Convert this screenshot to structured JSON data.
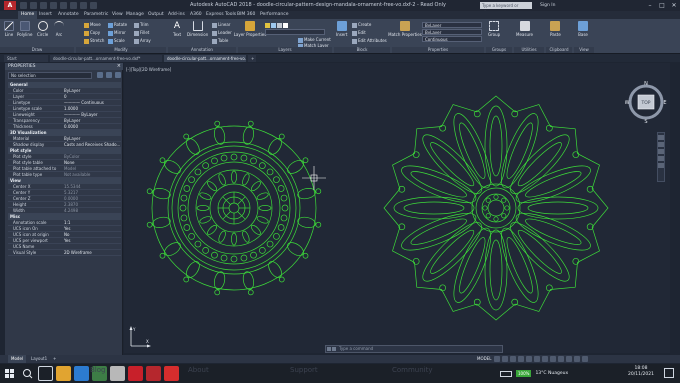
{
  "window": {
    "app_icon": "A",
    "title": "Autodesk AutoCAD 2018 - doodle-circular-pattern-design-mandala-ornament-free-vo.dxf-2 - Read Only",
    "search_placeholder": "Type a keyword or phrase",
    "signin": "Sign In"
  },
  "menu": [
    "Home",
    "Insert",
    "Annotate",
    "Parametric",
    "View",
    "Manage",
    "Output",
    "Add-ins",
    "A360",
    "Express Tools",
    "BIM 360",
    "Performance"
  ],
  "ribbon": {
    "draw": {
      "line": "Line",
      "polyline": "Polyline",
      "circle": "Circle",
      "arc": "Arc",
      "panel": "Draw"
    },
    "modify": {
      "move": "Move",
      "rotate": "Rotate",
      "trim": "Trim",
      "copy": "Copy",
      "mirror": "Mirror",
      "fillet": "Fillet",
      "stretch": "Stretch",
      "scale": "Scale",
      "array": "Array",
      "panel": "Modify"
    },
    "annotation": {
      "text": "Text",
      "dimension": "Dimension",
      "linear": "Linear",
      "leader": "Leader",
      "table": "Table",
      "panel": "Annotation"
    },
    "layers": {
      "layer_properties": "Layer Properties",
      "make_current": "Make Current",
      "match_layer": "Match Layer",
      "panel": "Layers"
    },
    "block": {
      "insert": "Insert",
      "create": "Create",
      "edit": "Edit",
      "edit_attributes": "Edit Attributes",
      "panel": "Block"
    },
    "properties": {
      "match_properties": "Match Properties",
      "bylayer1": "ByLayer",
      "bylayer2": "ByLayer",
      "continuous": "Continuous",
      "panel": "Properties"
    },
    "groups": {
      "group": "Group",
      "panel": "Groups"
    },
    "utilities": {
      "measure": "Measure",
      "panel": "Utilities"
    },
    "clipboard": {
      "paste": "Paste",
      "panel": "Clipboard"
    },
    "view": {
      "base": "Base",
      "panel": "View"
    }
  },
  "doc_tabs": [
    "Start",
    "doodle-circular-patt...ornament-free-vo.dxf*",
    "doodle-circular-patt...ornament-free-vo.dxf-2*"
  ],
  "properties_panel": {
    "title": "PROPERTIES",
    "selection": "No selection",
    "sections": [
      {
        "name": "General",
        "rows": [
          {
            "k": "Color",
            "v": "ByLayer"
          },
          {
            "k": "Layer",
            "v": "0"
          },
          {
            "k": "Linetype",
            "v": "———— Continuous"
          },
          {
            "k": "Linetype scale",
            "v": "1.0000"
          },
          {
            "k": "Lineweight",
            "v": "———— ByLayer"
          },
          {
            "k": "Transparency",
            "v": "ByLayer"
          },
          {
            "k": "Thickness",
            "v": "0.0000"
          }
        ]
      },
      {
        "name": "3D Visualization",
        "rows": [
          {
            "k": "Material",
            "v": "ByLayer"
          },
          {
            "k": "Shadow display",
            "v": "Casts and Receives Shado..."
          }
        ]
      },
      {
        "name": "Plot style",
        "rows": [
          {
            "k": "Plot style",
            "v": "ByColor",
            "dim": true
          },
          {
            "k": "Plot style table",
            "v": "None"
          },
          {
            "k": "Plot table attached to",
            "v": "Model",
            "dim": true
          },
          {
            "k": "Plot table type",
            "v": "Not available",
            "dim": true
          }
        ]
      },
      {
        "name": "View",
        "rows": [
          {
            "k": "Center X",
            "v": "15.5344",
            "dim": true
          },
          {
            "k": "Center Y",
            "v": "5.3217",
            "dim": true
          },
          {
            "k": "Center Z",
            "v": "0.0000",
            "dim": true
          },
          {
            "k": "Height",
            "v": "2.3870",
            "dim": true
          },
          {
            "k": "Width",
            "v": "4.2498",
            "dim": true
          }
        ]
      },
      {
        "name": "Misc",
        "rows": [
          {
            "k": "Annotation scale",
            "v": "1:1"
          },
          {
            "k": "UCS icon On",
            "v": "Yes"
          },
          {
            "k": "UCS icon at origin",
            "v": "No"
          },
          {
            "k": "UCS per viewport",
            "v": "Yes"
          },
          {
            "k": "UCS Name",
            "v": ""
          },
          {
            "k": "Visual Style",
            "v": "2D Wireframe"
          }
        ]
      }
    ]
  },
  "viewport": {
    "label": "[-][Top][2D Wireframe]",
    "viewcube": {
      "n": "N",
      "s": "S",
      "e": "E",
      "w": "W",
      "face": "TOP"
    },
    "ucs": {
      "x": "X",
      "y": "Y"
    },
    "drawing_color": "#3ddc3a",
    "bg_color": "#212836"
  },
  "command_line": {
    "placeholder": "Type a command"
  },
  "layout_tabs": [
    "Model",
    "Layout1",
    "+"
  ],
  "status": {
    "model": "MODEL"
  },
  "taskbar": {
    "faint": [
      "Blog",
      "About",
      "Support",
      "Community"
    ],
    "battery": "100%",
    "weather": "13°C  Nuageux",
    "time": "18:08",
    "date": "20/11/2021"
  },
  "colors": {
    "accent": "#3ddc3a",
    "ribbon": "#3a4456",
    "panel": "#303848",
    "autocad_red": "#b5272d"
  }
}
